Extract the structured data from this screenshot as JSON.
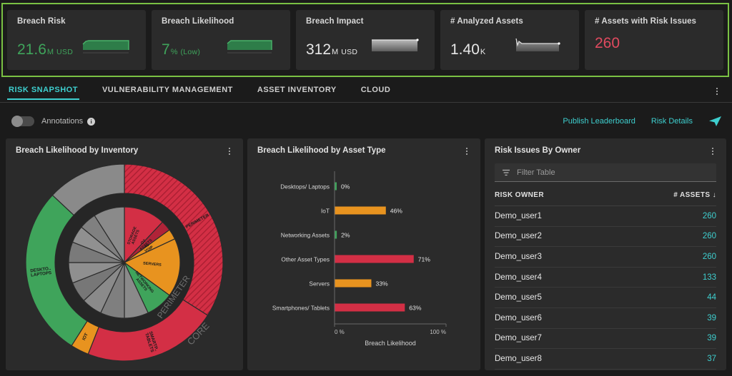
{
  "kpis": [
    {
      "title": "Breach Risk",
      "value": "21.6",
      "unit": "M",
      "suffix": "USD",
      "color": "green",
      "spark": "green-flat"
    },
    {
      "title": "Breach Likelihood",
      "value": "7",
      "unit": "%",
      "suffix": "(Low)",
      "color": "green",
      "spark": "green-flat"
    },
    {
      "title": "Breach Impact",
      "value": "312",
      "unit": "M",
      "suffix": "USD",
      "color": "white",
      "spark": "gray-flat"
    },
    {
      "title": "# Analyzed Assets",
      "value": "1.40",
      "unit": "K",
      "suffix": "",
      "color": "white",
      "spark": "gray-spike"
    },
    {
      "title": "# Assets with Risk Issues",
      "value": "260",
      "unit": "",
      "suffix": "",
      "color": "red",
      "spark": "none"
    }
  ],
  "tabs": [
    {
      "label": "RISK SNAPSHOT",
      "active": true
    },
    {
      "label": "VULNERABILITY MANAGEMENT",
      "active": false
    },
    {
      "label": "ASSET INVENTORY",
      "active": false
    },
    {
      "label": "CLOUD",
      "active": false
    }
  ],
  "toolbar": {
    "annotations_label": "Annotations",
    "annotations_on": false,
    "info_glyph": "i",
    "publish_leaderboard": "Publish Leaderboard",
    "risk_details": "Risk Details",
    "send_icon": "send-icon"
  },
  "panels": {
    "donut": {
      "title": "Breach Likelihood by Inventory"
    },
    "bar": {
      "title": "Breach Likelihood by Asset Type"
    },
    "table": {
      "title": "Risk Issues By Owner"
    }
  },
  "table": {
    "filter_placeholder": "Filter Table",
    "columns": [
      "RISK OWNER",
      "# ASSETS"
    ],
    "sort_arrow": "↓",
    "rows": [
      {
        "owner": "Demo_user1",
        "assets": "260"
      },
      {
        "owner": "Demo_user2",
        "assets": "260"
      },
      {
        "owner": "Demo_user3",
        "assets": "260"
      },
      {
        "owner": "Demo_user4",
        "assets": "133"
      },
      {
        "owner": "Demo_user5",
        "assets": "44"
      },
      {
        "owner": "Demo_user6",
        "assets": "39"
      },
      {
        "owner": "Demo_user7",
        "assets": "39"
      },
      {
        "owner": "Demo_user8",
        "assets": "37"
      }
    ]
  },
  "colors": {
    "accent_teal": "#3ecfcf",
    "green": "#3fa45b",
    "red": "#d32f45",
    "orange": "#e8931f",
    "gray": "#8a8a8a",
    "selection_border": "#7ac143"
  },
  "chart_data": [
    {
      "type": "bar",
      "title": "Breach Likelihood by Asset Type",
      "orientation": "horizontal",
      "categories": [
        "Desktops/ Laptops",
        "IoT",
        "Networking Assets",
        "Other Asset Types",
        "Servers",
        "Smartphones/ Tablets"
      ],
      "values": [
        0,
        46,
        2,
        71,
        33,
        63
      ],
      "value_labels": [
        "0%",
        "46%",
        "2%",
        "71%",
        "33%",
        "63%"
      ],
      "bar_colors": [
        "#3fa45b",
        "#e8931f",
        "#3fa45b",
        "#d32f45",
        "#e8931f",
        "#d32f45"
      ],
      "xlabel": "Breach Likelihood",
      "ylabel": "",
      "xlim": [
        0,
        100
      ],
      "xticks": [
        "0 %",
        "100 %"
      ],
      "grid": false,
      "legend": "none"
    },
    {
      "type": "pie",
      "title": "Breach Likelihood by Inventory",
      "subtype": "nested-donut",
      "rings": [
        {
          "name": "PERIMETER",
          "ring_label": "PERIMETER",
          "slices": [
            {
              "label": "PERIMETER",
              "value": 34,
              "color": "#d32f45",
              "hatched": true
            },
            {
              "label": "SMARTP../TABLETS",
              "value": 22,
              "color": "#d32f45",
              "hatched": false
            },
            {
              "label": "IOT",
              "value": 3,
              "color": "#e8931f",
              "hatched": false
            },
            {
              "label": "DESKTO../LAPTOPS",
              "value": 28,
              "color": "#3fa45b",
              "hatched": false
            },
            {
              "label": "",
              "value": 13,
              "color": "#8a8a8a",
              "hatched": false
            }
          ]
        },
        {
          "name": "CORE",
          "ring_label": "CORE",
          "slices": [
            {
              "label": "STORAGE ASSETS",
              "value": 12,
              "color": "#d32f45"
            },
            {
              "label": "OT ASSETS",
              "value": 3,
              "color": "#b02338"
            },
            {
              "label": "AV/VOIP",
              "value": 3,
              "color": "#e8931f"
            },
            {
              "label": "SERVERS",
              "value": 17,
              "color": "#e8931f"
            },
            {
              "label": "NETWORKING ASSETS",
              "value": 8,
              "color": "#3fa45b"
            },
            {
              "label": "",
              "value": 7,
              "color": "#8a8a8a"
            },
            {
              "label": "",
              "value": 7,
              "color": "#7f7f7f"
            },
            {
              "label": "",
              "value": 6,
              "color": "#8a8a8a"
            },
            {
              "label": "",
              "value": 6,
              "color": "#777777"
            },
            {
              "label": "",
              "value": 6,
              "color": "#8f8f8f"
            },
            {
              "label": "",
              "value": 6,
              "color": "#7a7a7a"
            },
            {
              "label": "",
              "value": 5,
              "color": "#909090"
            },
            {
              "label": "",
              "value": 5,
              "color": "#808080"
            },
            {
              "label": "",
              "value": 9,
              "color": "#8a8a8a"
            }
          ]
        }
      ],
      "legend": "none"
    }
  ]
}
